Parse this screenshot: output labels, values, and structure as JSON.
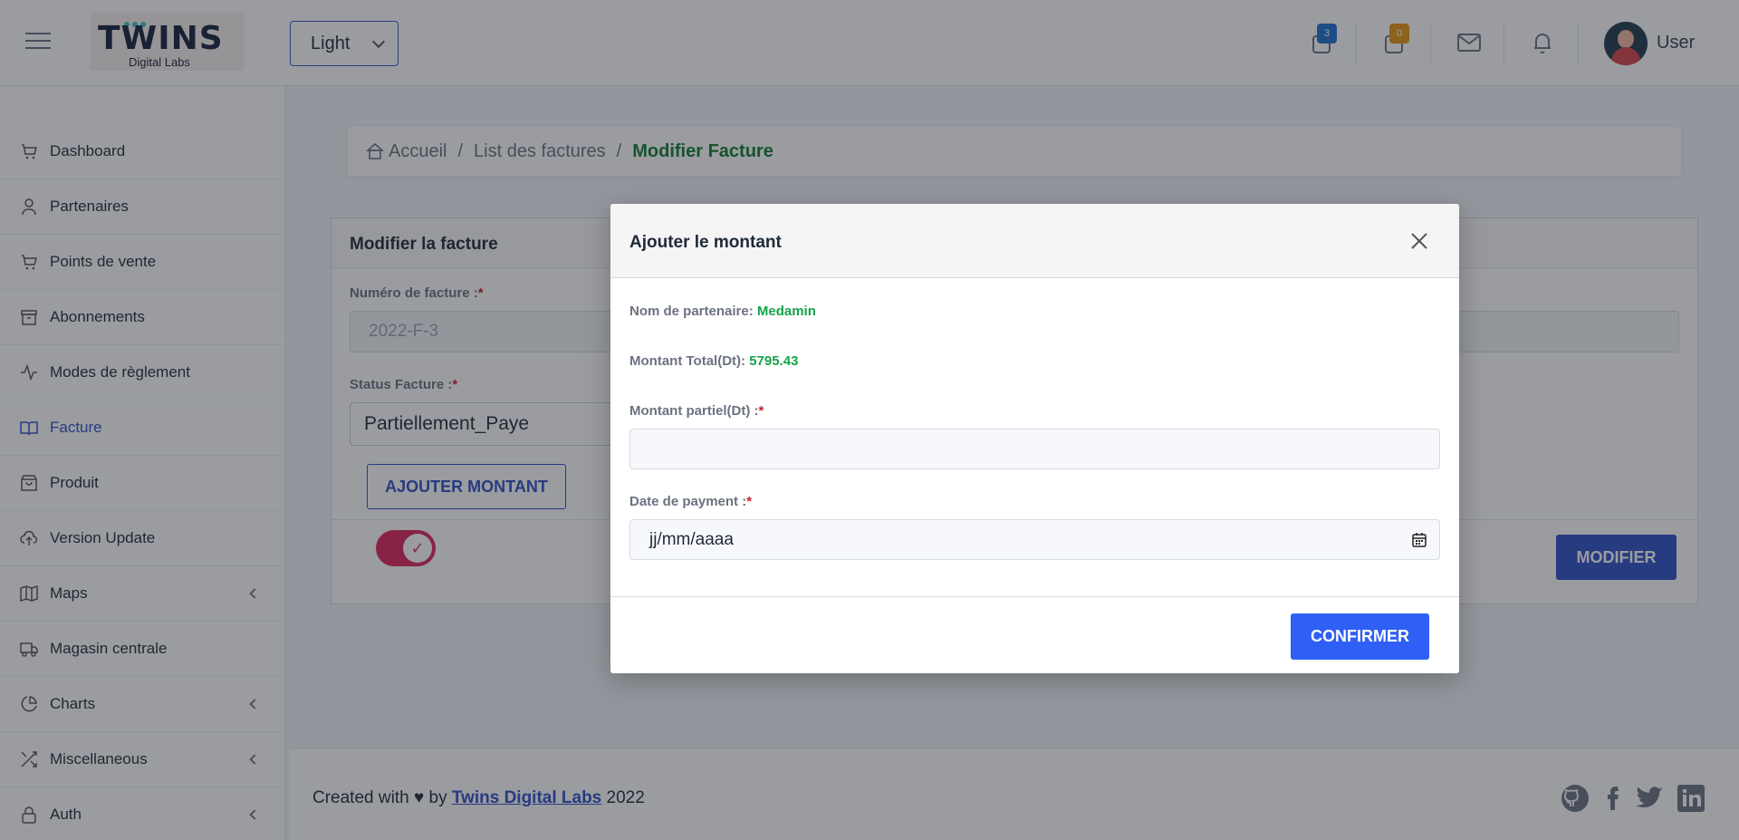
{
  "header": {
    "logo_word": "TWINS",
    "logo_sub": "Digital Labs",
    "theme_value": "Light",
    "badge_blue": "3",
    "badge_orange": "0",
    "user_name": "User",
    "colors": {
      "badge_blue": "#1e6fd0",
      "badge_orange": "#e69510"
    }
  },
  "sidebar": {
    "items": [
      {
        "label": "Dashboard",
        "icon": "cart-icon"
      },
      {
        "label": "Partenaires",
        "icon": "user-icon"
      },
      {
        "label": "Points de vente",
        "icon": "cart-icon"
      },
      {
        "label": "Abonnements",
        "icon": "archive-icon"
      },
      {
        "label": "Modes de règlement",
        "icon": "activity-icon"
      },
      {
        "label": "Facture",
        "icon": "book-icon",
        "active": true
      },
      {
        "label": "Produit",
        "icon": "shopping-bag-icon"
      },
      {
        "label": "Version Update",
        "icon": "upload-cloud-icon"
      },
      {
        "label": "Maps",
        "icon": "map-icon",
        "expandable": true
      },
      {
        "label": "Magasin centrale",
        "icon": "truck-icon"
      },
      {
        "label": "Charts",
        "icon": "pie-chart-icon",
        "expandable": true
      },
      {
        "label": "Miscellaneous",
        "icon": "shuffle-icon",
        "expandable": true
      },
      {
        "label": "Auth",
        "icon": "lock-icon",
        "expandable": true
      }
    ]
  },
  "breadcrumb": {
    "home": "Accueil",
    "sep": "/",
    "list": "List des factures",
    "current": "Modifier Facture"
  },
  "form": {
    "title": "Modifier la facture",
    "numero_label": "Numéro de facture :",
    "numero_value": "2022-F-3",
    "status_label": "Status Facture :",
    "status_value": "Partiellement_Paye",
    "required_mark": "*",
    "add_amount_button": "AJOUTER MONTANT",
    "modify_button": "MODIFIER",
    "toggle_on": true
  },
  "modal": {
    "title": "Ajouter le montant",
    "partner_label": "Nom de partenaire:",
    "partner_value": "Medamin",
    "total_label": "Montant Total(Dt):",
    "total_value": "5795.43",
    "partial_label": "Montant partiel(Dt) :",
    "partial_value": "",
    "date_label": "Date de payment :",
    "date_placeholder": "jj/mm/aaaa",
    "required_mark": "*",
    "confirm_button": "CONFIRMER"
  },
  "footer": {
    "prefix": "Created with ♥ by",
    "link": "Twins Digital Labs",
    "year": "2022",
    "socials": [
      "github-icon",
      "facebook-icon",
      "twitter-icon",
      "linkedin-icon"
    ]
  }
}
